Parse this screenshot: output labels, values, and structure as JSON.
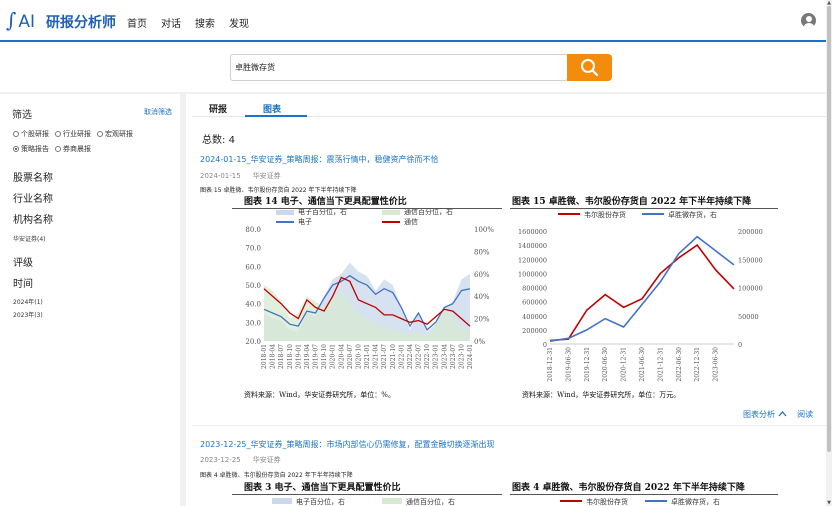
{
  "header": {
    "logo_symbol": "∫",
    "logo_text": "AI",
    "brand": "研报分析师",
    "nav": [
      "首页",
      "对话",
      "搜索",
      "发现"
    ],
    "user_icon": "user-circle-icon"
  },
  "search": {
    "value": "卓胜微存货",
    "button_icon": "search-icon",
    "button_color": "#f38b0d"
  },
  "sidebar": {
    "title": "筛选",
    "clear": "取消筛选",
    "radios": [
      {
        "label": "个股研报",
        "checked": false
      },
      {
        "label": "行业研报",
        "checked": false
      },
      {
        "label": "宏观研报",
        "checked": false
      },
      {
        "label": "策略报告",
        "checked": true
      },
      {
        "label": "券商晨报",
        "checked": false
      }
    ],
    "sections": [
      "股票名称",
      "行业名称",
      "机构名称"
    ],
    "org_item": "华安证券(4)",
    "rating": "评级",
    "time": "时间",
    "time_items": [
      "2024年(1)",
      "2023年(3)"
    ]
  },
  "main": {
    "tabs": [
      "研报",
      "图表"
    ],
    "active_tab": "图表",
    "total_label": "总数:",
    "total_value": "4",
    "actions": {
      "analysis": "图表分析",
      "chevron_icon": "chevron-up-icon",
      "read": "阅读"
    },
    "results": [
      {
        "title": "2024-01-15_华安证券_策略周报：震荡行情中，稳健资产徐而不恰",
        "date": "2024-01-15",
        "source": "华安证券",
        "caption": "图表 15 卓胜微、韦尔股份存货自 2022 年下半年持续下降"
      },
      {
        "title": "2023-12-25_华安证券_策略周报：市场内部信心仍需修复，配置金融切换逐渐出现",
        "date": "2023-12-25",
        "source": "华安证券",
        "caption": "图表 4 卓胜微、韦尔股份存货自 2022 年下半年持续下降"
      }
    ]
  },
  "chart_data": [
    {
      "type": "line",
      "title": "图表 14 电子、通信当下更具配置性价比",
      "source_note": "资料来源：Wind，华安证券研究所，单位：%。",
      "legend": [
        "电子百分位，右",
        "通信百分位，右",
        "电子",
        "通信"
      ],
      "x": [
        "2018-01",
        "2018-04",
        "2018-07",
        "2018-10",
        "2019-01",
        "2019-04",
        "2019-07",
        "2019-10",
        "2020-01",
        "2020-04",
        "2020-07",
        "2020-10",
        "2021-01",
        "2021-04",
        "2021-07",
        "2021-10",
        "2022-01",
        "2022-04",
        "2022-07",
        "2022-10",
        "2023-01",
        "2023-04",
        "2023-07",
        "2023-10",
        "2024-01"
      ],
      "series": [
        {
          "name": "电子百分位，右",
          "axis": "right",
          "values": [
            0.25,
            0.2,
            0.18,
            0.1,
            0.08,
            0.25,
            0.22,
            0.4,
            0.55,
            0.6,
            0.7,
            0.62,
            0.58,
            0.45,
            0.55,
            0.5,
            0.3,
            0.1,
            0.25,
            0.08,
            0.15,
            0.3,
            0.35,
            0.55,
            0.6
          ]
        },
        {
          "name": "通信百分位，右",
          "axis": "right",
          "values": [
            0.5,
            0.45,
            0.35,
            0.2,
            0.25,
            0.4,
            0.35,
            0.3,
            0.4,
            0.45,
            0.35,
            0.25,
            0.2,
            0.15,
            0.12,
            0.1,
            0.08,
            0.06,
            0.08,
            0.05,
            0.15,
            0.3,
            0.22,
            0.12,
            0.1
          ]
        },
        {
          "name": "电子",
          "axis": "left",
          "values": [
            37,
            35,
            33,
            29,
            28,
            36,
            35,
            43,
            50,
            52,
            55,
            52,
            50,
            45,
            48,
            46,
            38,
            28,
            35,
            26,
            30,
            38,
            40,
            47,
            48
          ]
        },
        {
          "name": "通信",
          "axis": "left",
          "values": [
            48,
            44,
            40,
            35,
            32,
            42,
            38,
            36,
            44,
            54,
            52,
            42,
            40,
            38,
            34,
            34,
            32,
            30,
            31,
            29,
            33,
            37,
            36,
            32,
            28
          ]
        }
      ],
      "ylim_left": [
        20,
        80
      ],
      "yticks_left": [
        "80.0",
        "70.0",
        "60.0",
        "50.0",
        "40.0",
        "30.0",
        "20.0"
      ],
      "ylim_right": [
        0,
        1
      ],
      "yticks_right": [
        "100%",
        "80%",
        "60%",
        "40%",
        "20%",
        "0%"
      ],
      "xticks": [
        "2018-01",
        "2018-04",
        "2018-07",
        "2018-10",
        "2019-01",
        "2019-04",
        "2019-07",
        "2019-10",
        "2020-01",
        "2020-04",
        "2020-07",
        "2020-10",
        "2021-01",
        "2021-04",
        "2021-07",
        "2021-10",
        "2022-01",
        "2022-04",
        "2022-07",
        "2022-10",
        "2023-01",
        "2023-04",
        "2023-07",
        "2023-10",
        "2024-01"
      ]
    },
    {
      "type": "line",
      "title": "图表 15 卓胜微、韦尔股份存货自 2022 年下半年持续下降",
      "source_note": "资料来源：Wind，华安证券研究所，单位：万元。",
      "legend": [
        "韦尔股份存货",
        "卓胜微存货，右"
      ],
      "x": [
        "2018-12-31",
        "2019-06-30",
        "2019-12-31",
        "2020-06-30",
        "2020-12-31",
        "2021-06-30",
        "2021-12-31",
        "2022-06-30",
        "2022-12-31",
        "2023-06-30",
        "2023-09-30"
      ],
      "series": [
        {
          "name": "韦尔股份存货",
          "axis": "left",
          "values": [
            50000,
            70000,
            480000,
            700000,
            520000,
            640000,
            1000000,
            1220000,
            1400000,
            1050000,
            780000
          ]
        },
        {
          "name": "卓胜微存货，右",
          "axis": "right",
          "values": [
            5000,
            10000,
            25000,
            45000,
            30000,
            70000,
            110000,
            160000,
            190000,
            165000,
            140000
          ]
        }
      ],
      "ylim_left": [
        0,
        1600000
      ],
      "yticks_left": [
        "1600000",
        "1400000",
        "1200000",
        "1000000",
        "800000",
        "600000",
        "400000",
        "200000",
        "0"
      ],
      "ylim_right": [
        0,
        200000
      ],
      "yticks_right": [
        "200000",
        "150000",
        "100000",
        "50000",
        "0"
      ],
      "xticks": [
        "2018-12-31",
        "2019-06-30",
        "2019-12-31",
        "2020-06-30",
        "2020-12-31",
        "2021-06-30",
        "2021-12-31",
        "2022-06-30",
        "2022-12-31",
        "2023-06-30"
      ]
    },
    {
      "type": "line",
      "title": "图表 3 电子、通信当下更具配置性价比",
      "legend": [
        "电子百分位，右",
        "通信百分位，右"
      ],
      "series": []
    },
    {
      "type": "line",
      "title": "图表 4 卓胜微、韦尔股份存货自 2022 年下半年持续下降",
      "legend": [
        "韦尔股份存货",
        "卓胜微存货，右"
      ],
      "series": []
    }
  ],
  "colors": {
    "accent": "#1a73c7",
    "red_series": "#c00000",
    "blue_series": "#4472c4",
    "elec_pct_fill": "#c9d8ec",
    "comm_pct_fill": "#d7e9d2"
  }
}
